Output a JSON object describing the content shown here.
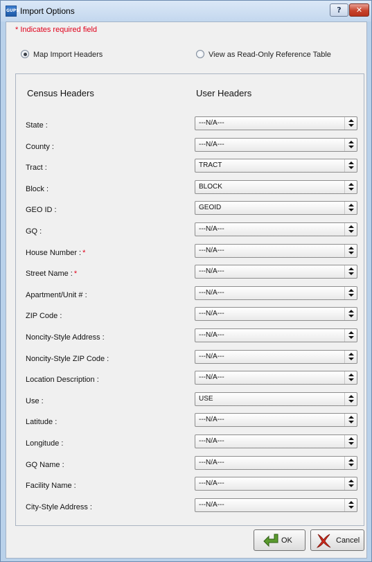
{
  "window": {
    "title": "Import Options",
    "app_icon_text": "GUPS",
    "help_label": "?",
    "close_label": "✕"
  },
  "required_note": "* Indicates required field",
  "mode": {
    "map_label": "Map Import Headers",
    "map_checked": true,
    "view_label": "View as Read-Only Reference Table",
    "view_checked": false
  },
  "headers": {
    "census": "Census Headers",
    "user": "User Headers"
  },
  "rows": [
    {
      "label": "State :",
      "required": false,
      "value": "---N/A---"
    },
    {
      "label": "County :",
      "required": false,
      "value": "---N/A---"
    },
    {
      "label": "Tract :",
      "required": false,
      "value": "TRACT"
    },
    {
      "label": "Block :",
      "required": false,
      "value": "BLOCK"
    },
    {
      "label": "GEO ID :",
      "required": false,
      "value": "GEOID"
    },
    {
      "label": "GQ :",
      "required": false,
      "value": "---N/A---"
    },
    {
      "label": "House Number :",
      "required": true,
      "value": "---N/A---"
    },
    {
      "label": "Street Name :",
      "required": true,
      "value": "---N/A---"
    },
    {
      "label": "Apartment/Unit # :",
      "required": false,
      "value": "---N/A---"
    },
    {
      "label": "ZIP Code :",
      "required": false,
      "value": "---N/A---"
    },
    {
      "label": "Noncity-Style Address :",
      "required": false,
      "value": "---N/A---"
    },
    {
      "label": "Noncity-Style ZIP Code :",
      "required": false,
      "value": "---N/A---"
    },
    {
      "label": "Location Description :",
      "required": false,
      "value": "---N/A---"
    },
    {
      "label": "Use :",
      "required": false,
      "value": "USE"
    },
    {
      "label": "Latitude :",
      "required": false,
      "value": "---N/A---"
    },
    {
      "label": "Longitude :",
      "required": false,
      "value": "---N/A---"
    },
    {
      "label": "GQ Name :",
      "required": false,
      "value": "---N/A---"
    },
    {
      "label": "Facility Name :",
      "required": false,
      "value": "---N/A---"
    },
    {
      "label": "City-Style Address :",
      "required": false,
      "value": "---N/A---"
    }
  ],
  "required_star": "*",
  "buttons": {
    "ok_label": "OK",
    "ok_icon": "green-arrow-icon",
    "cancel_label": "Cancel",
    "cancel_icon": "red-x-icon"
  },
  "colors": {
    "required": "#e0001a",
    "title_bar": "#c3d7ee",
    "close_button": "#c7432d"
  }
}
